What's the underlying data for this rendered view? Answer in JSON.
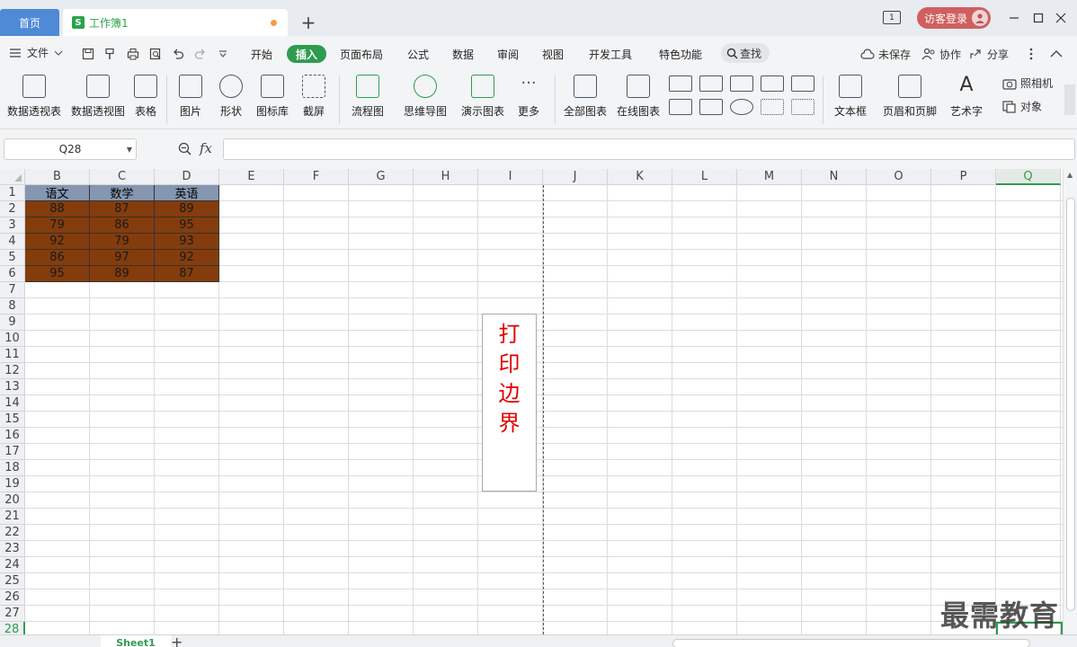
{
  "titlebar": {
    "home_tab": "首页",
    "doc_icon_letter": "S",
    "doc_title": "工作簿1",
    "new_tab": "+",
    "window_badge": "1",
    "guest_login": "访客登录"
  },
  "menubar": {
    "file": "文件",
    "items": [
      "开始",
      "插入",
      "页面布局",
      "公式",
      "数据",
      "审阅",
      "视图",
      "开发工具",
      "特色功能"
    ],
    "active_item": "插入",
    "search": "查找",
    "unsaved": "未保存",
    "collaborate": "协作",
    "share": "分享"
  },
  "ribbon": {
    "buttons": [
      "数据透视表",
      "数据透视图",
      "表格",
      "图片",
      "形状",
      "图标库",
      "截屏",
      "流程图",
      "思维导图",
      "演示图表",
      "更多",
      "全部图表",
      "在线图表",
      "文本框",
      "页眉和页脚",
      "艺术字"
    ],
    "camera": "照相机",
    "object": "对象"
  },
  "formula": {
    "cell_ref": "Q28",
    "fx": "fx",
    "value": ""
  },
  "sheet": {
    "columns": [
      "B",
      "C",
      "D",
      "E",
      "F",
      "G",
      "H",
      "I",
      "J",
      "K",
      "L",
      "M",
      "N",
      "O",
      "P",
      "Q"
    ],
    "selected_column": "Q",
    "rows": [
      "1",
      "2",
      "3",
      "4",
      "5",
      "6",
      "7",
      "8",
      "9",
      "10",
      "11",
      "12",
      "13",
      "14",
      "15",
      "16",
      "17",
      "18",
      "19",
      "20",
      "21",
      "22",
      "23",
      "24",
      "25",
      "26",
      "27",
      "28"
    ],
    "selected_row": "28",
    "table_header": [
      "语文",
      "数学",
      "英语"
    ],
    "table_rows": [
      [
        "88",
        "87",
        "89"
      ],
      [
        "79",
        "86",
        "95"
      ],
      [
        "92",
        "79",
        "93"
      ],
      [
        "86",
        "97",
        "92"
      ],
      [
        "95",
        "89",
        "87"
      ]
    ],
    "print_border_label": "打印边界",
    "header_color": "#8496b0",
    "body_color": "#843c0c",
    "accent_color": "#2e9c4f"
  },
  "sheetbar": {
    "tab": "Sheet1",
    "add": "+"
  },
  "watermark": "最需教育"
}
